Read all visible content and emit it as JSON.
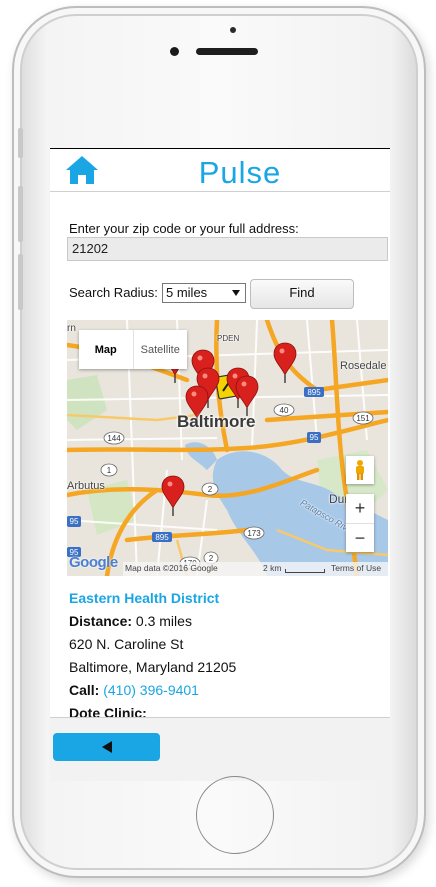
{
  "app": {
    "title": "Pulse"
  },
  "form": {
    "address_label": "Enter your zip code or your full address:",
    "address_value": "21202",
    "radius_label": "Search Radius:",
    "radius_selected": "5 miles",
    "find_label": "Find"
  },
  "map": {
    "type_map": "Map",
    "type_satellite": "Satellite",
    "city": "Baltimore",
    "labels": [
      "Rosedale",
      "Arbutus",
      "Dun",
      "Patapsco River",
      "PDEN",
      "rn"
    ],
    "road_shields": [
      "895",
      "40",
      "151",
      "144",
      "1",
      "95",
      "2",
      "173",
      "895",
      "170",
      "95",
      "2",
      "95"
    ],
    "attribution": "Map data ©2016 Google",
    "scale": "2 km",
    "terms": "Terms of Use",
    "google": "Google",
    "zoom_in": "+",
    "zoom_out": "−",
    "colors": {
      "water": "#a8c8e8",
      "highway": "#f5a623",
      "land": "#e9e5dc",
      "pin": "#d8201c"
    }
  },
  "result": {
    "name": "Eastern Health District",
    "distance_label": "Distance:",
    "distance_value": "0.3 miles",
    "street": "620 N. Caroline St",
    "city_line": "Baltimore, Maryland 21205",
    "call_label": "Call:",
    "phone": "(410) 396-9401",
    "next_heading": "Dote Clinic:"
  },
  "icons": {
    "home": "home-icon",
    "back": "back-arrow-icon",
    "pegman": "pegman-icon",
    "pin": "map-pin-icon"
  },
  "colors": {
    "accent": "#1aa6e4"
  }
}
